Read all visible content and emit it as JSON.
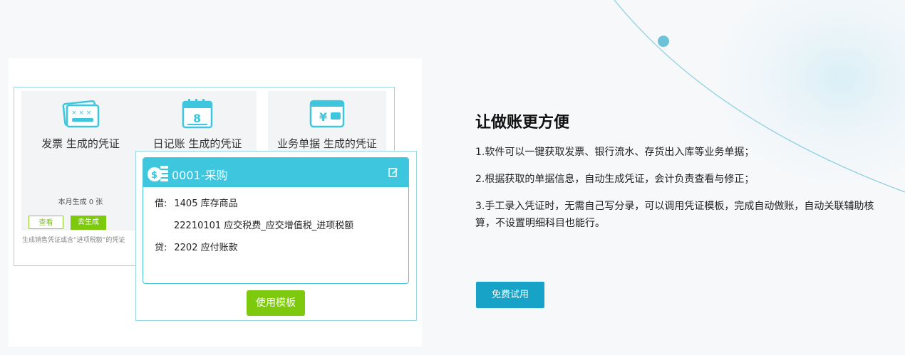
{
  "illustration": {
    "columns": [
      {
        "title": "发票 生成的凭证",
        "icon": "invoice-icon"
      },
      {
        "title": "日记账 生成的凭证",
        "icon": "calendar-journal-icon"
      },
      {
        "title": "业务单据 生成的凭证",
        "icon": "wallet-yen-icon"
      }
    ],
    "month_count": "本月生成 0 张",
    "view_label": "查看",
    "generate_label": "去生成",
    "footnote": "生成销售凭证或含“进项税额”的凭证",
    "voucher": {
      "title": "0001-采购",
      "entries": [
        {
          "direction": "借:",
          "account": "1405 库存商品"
        },
        {
          "direction": "",
          "account": "22210101 应交税费_应交增值税_进项税额"
        },
        {
          "direction": "贷:",
          "account": "2202 应付账款"
        }
      ],
      "template_button": "使用模板"
    }
  },
  "feature": {
    "title": "让做账更方便",
    "points": [
      "1.软件可以一键获取发票、银行流水、存货出入库等业务单据；",
      "2.根据获取的单据信息，自动生成凭证，会计负责查看与修正；",
      "3.手工录入凭证时，无需自己写分录，可以调用凭证模板，完成自动做账，自动关联辅助核算，不设置明细科目也能行。"
    ],
    "cta_label": "免费试用"
  },
  "colors": {
    "accent_cyan": "#3ec6de",
    "button_green": "#7cc90e",
    "cta_blue": "#17a2c7"
  }
}
